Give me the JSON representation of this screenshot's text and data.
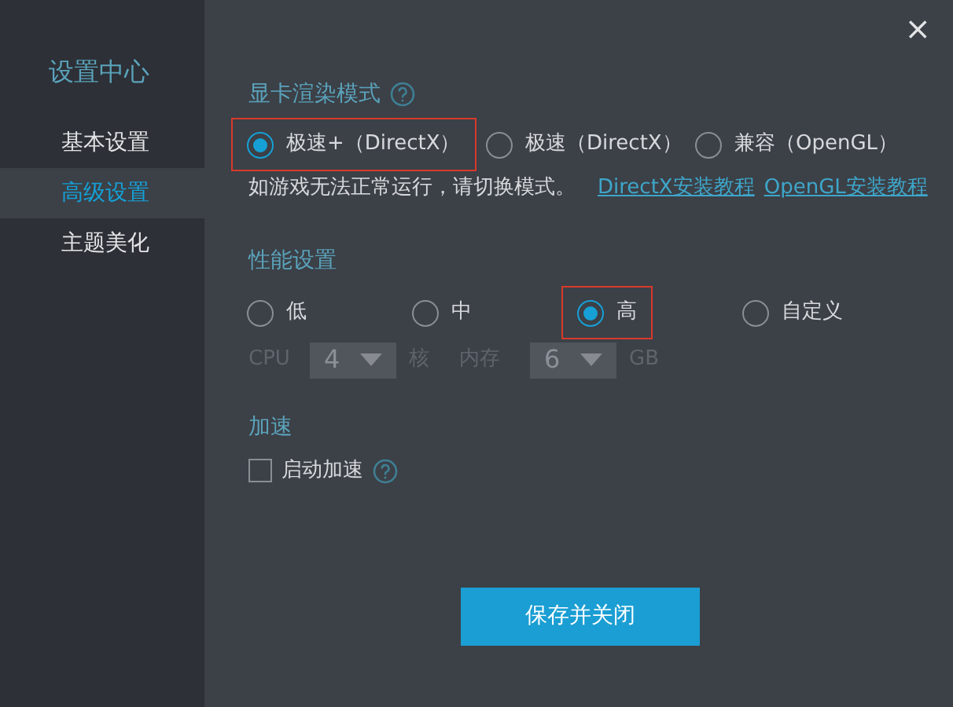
{
  "sidebar": {
    "title": "设置中心",
    "items": [
      {
        "label": "基本设置",
        "selected": false
      },
      {
        "label": "高级设置",
        "selected": true
      },
      {
        "label": "主题美化",
        "selected": false
      }
    ]
  },
  "close": "×",
  "render_mode": {
    "title": "显卡渲染模式",
    "options": [
      {
        "label": "极速+（DirectX）",
        "selected": true,
        "highlighted": true
      },
      {
        "label": "极速（DirectX）",
        "selected": false,
        "highlighted": false
      },
      {
        "label": "兼容（OpenGL）",
        "selected": false,
        "highlighted": false
      }
    ],
    "note": "如游戏无法正常运行，请切换模式。",
    "links": [
      "DirectX安装教程",
      "OpenGL安装教程"
    ]
  },
  "performance": {
    "title": "性能设置",
    "options": [
      {
        "label": "低",
        "selected": false,
        "highlighted": false
      },
      {
        "label": "中",
        "selected": false,
        "highlighted": false
      },
      {
        "label": "高",
        "selected": true,
        "highlighted": true
      },
      {
        "label": "自定义",
        "selected": false,
        "highlighted": false
      }
    ],
    "custom": {
      "disabled": true,
      "cpu_label": "CPU",
      "cpu_value": "4",
      "cpu_unit": "核",
      "mem_label": "内存",
      "mem_value": "6",
      "mem_unit": "GB"
    }
  },
  "acceleration": {
    "title": "加速",
    "checkbox": {
      "label": "启动加速",
      "checked": false
    }
  },
  "save_button": "保存并关闭"
}
